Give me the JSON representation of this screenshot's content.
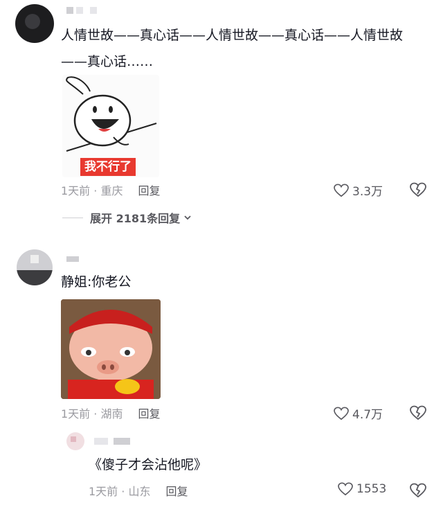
{
  "comments": [
    {
      "text": "人情世故——真心话——人情世故——真心话——人情世故——真心话……",
      "sticker_caption": "我不行了",
      "time_location": "1天前 · 重庆",
      "reply_label": "回复",
      "likes": "3.3万",
      "expand_label": "展开 2181条回复"
    },
    {
      "text": "静姐:你老公",
      "time_location": "1天前 · 湖南",
      "reply_label": "回复",
      "likes": "4.7万",
      "replies": [
        {
          "text": "《傻子才会沾他呢》",
          "time_location": "1天前 · 山东",
          "reply_label": "回复",
          "likes": "1553"
        }
      ]
    }
  ],
  "icons": {
    "like": "heart-outline-icon",
    "dislike": "broken-heart-icon",
    "expand": "chevron-down-icon"
  },
  "colors": {
    "sticker_caption_bg": "#e8392f",
    "meta_text": "#9a9aa0"
  }
}
